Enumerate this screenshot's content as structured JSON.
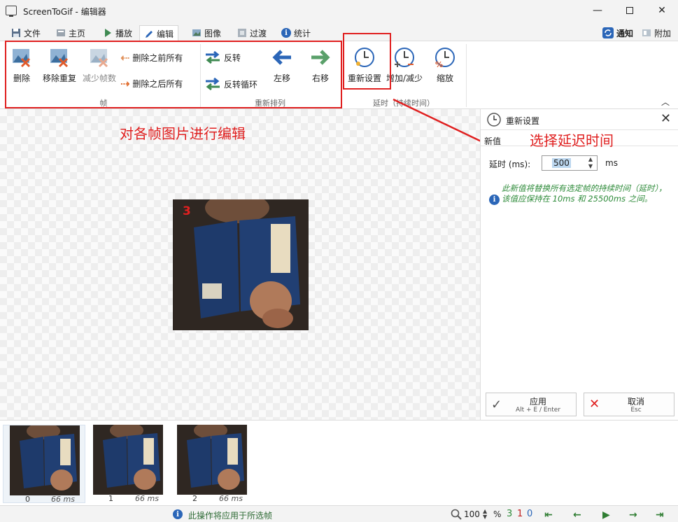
{
  "window": {
    "title": "ScreenToGif - 编辑器"
  },
  "menu": {
    "file": "文件",
    "home": "主页",
    "play": "播放",
    "edit": "编辑",
    "image": "图像",
    "transition": "过渡",
    "stats": "统计",
    "notify": "通知",
    "extras": "附加"
  },
  "ribbon": {
    "frames": {
      "delete": "删除",
      "remove_dup": "移除重复",
      "reduce": "减少帧数",
      "delete_prev": "删除之前所有",
      "delete_next": "删除之后所有",
      "label": "帧"
    },
    "reorder": {
      "reverse": "反转",
      "yoyo": "反转循环",
      "move_left": "左移",
      "move_right": "右移",
      "label": "重新排列"
    },
    "delay": {
      "override": "重新设置",
      "increase": "增加/减少",
      "scale": "缩放",
      "label": "延时（持续时间）"
    }
  },
  "annotations": {
    "edit_frames": "对各帧图片进行编辑",
    "choose_delay": "选择延迟时间"
  },
  "canvas": {
    "frame_number": "3"
  },
  "panel": {
    "title": "重新设置",
    "section": "新值",
    "delay_label": "延时 (ms):",
    "delay_value": "500",
    "unit": "ms",
    "info": "此新值将替换所有选定帧的持续时间（延时），该值应保持在 10ms 和 25500ms 之间。",
    "apply": "应用",
    "apply_shortcut": "Alt + E / Enter",
    "cancel": "取消",
    "cancel_shortcut": "Esc"
  },
  "frames": [
    {
      "index": "0",
      "duration": "66 ms"
    },
    {
      "index": "1",
      "duration": "66 ms"
    },
    {
      "index": "2",
      "duration": "66 ms"
    }
  ],
  "status": {
    "message": "此操作将应用于所选帧",
    "zoom": "100",
    "percent": "%",
    "count_total": "3",
    "count_selected": "1",
    "count_current": "0"
  },
  "colors": {
    "accent": "#2b66b8",
    "annotation": "#e02020",
    "info_text": "#2e8b3a"
  }
}
